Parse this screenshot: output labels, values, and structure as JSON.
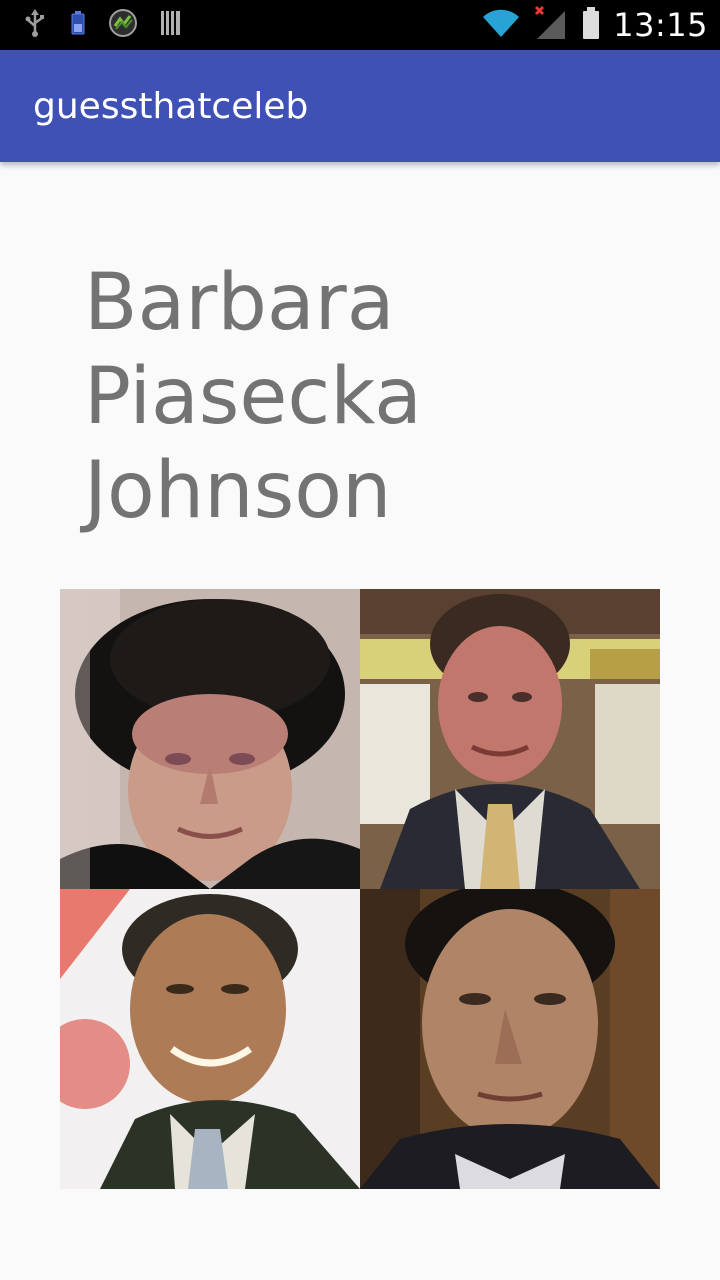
{
  "status_bar": {
    "time": "13:15",
    "icons": [
      "usb-icon",
      "battery-small-icon",
      "sync-app-icon",
      "barcode-icon",
      "wifi-icon",
      "signal-off-icon",
      "battery-icon"
    ]
  },
  "app_bar": {
    "title": "guessthatceleb",
    "color": "#3f51b5"
  },
  "question": {
    "name": "Barbara Piasecka Johnson"
  },
  "choices": [
    {
      "label": "woman-in-black-fur-hat-portrait"
    },
    {
      "label": "man-in-suit-yellow-tie-portrait"
    },
    {
      "label": "smiling-man-in-dark-suit-portrait"
    },
    {
      "label": "man-with-dark-hair-portrait"
    }
  ],
  "colors": {
    "background": "#fafafa",
    "question_text": "#737373"
  }
}
